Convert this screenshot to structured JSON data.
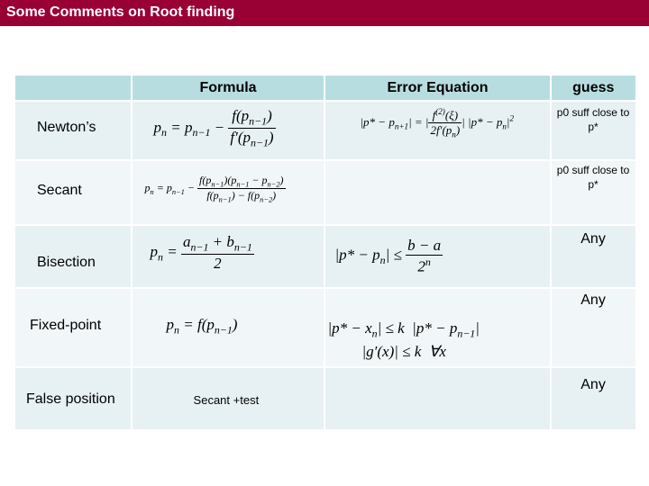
{
  "title": "Some Comments on Root finding",
  "table": {
    "headers": [
      "",
      "Formula",
      "Error Equation",
      "guess"
    ],
    "rows": [
      {
        "method": "Newton’s",
        "formula": "p_n = p_{n-1} - f(p_{n-1}) / f'(p_{n-1})",
        "error": "|p* - p_{n+1}| = |f^(2)(ξ) / 2f'(p_n)| |p* - p_n|^2",
        "guess": "p0 suff close to p*"
      },
      {
        "method": "Secant",
        "formula": "p_n = p_{n-1} - f(p_{n-1})(p_{n-1} - p_{n-2}) / (f(p_{n-1}) - f(p_{n-2}))",
        "error": "",
        "guess": "p0 suff close to p*"
      },
      {
        "method": "Bisection",
        "formula": "p_n = (a_{n-1} + b_{n-1}) / 2",
        "error": "|p* - p_n| ≤ (b - a) / 2^n",
        "guess": "Any"
      },
      {
        "method": "Fixed-point",
        "formula": "p_n = f(p_{n-1})",
        "error": "|p* - x_n| ≤ k |p* - p_{n-1}|; |g'(x)| ≤ k ∀x",
        "guess": "Any"
      },
      {
        "method": "False position",
        "formula": "Secant +test",
        "error": "",
        "guess": "Any"
      }
    ]
  }
}
